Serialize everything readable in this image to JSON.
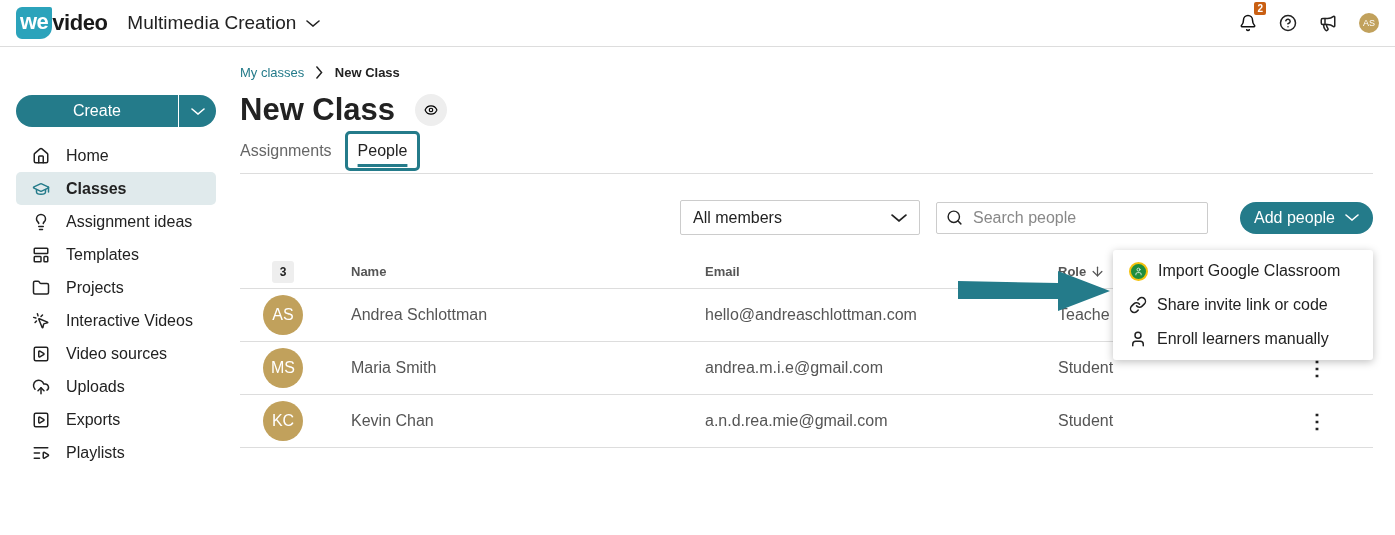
{
  "header": {
    "logo": {
      "mark": "we",
      "word": "video"
    },
    "workspace": "Multimedia Creation",
    "notification_count": "2",
    "avatar": "AS"
  },
  "sidebar": {
    "create_button": "Create",
    "items": [
      {
        "label": "Home",
        "selected": false
      },
      {
        "label": "Classes",
        "selected": true
      },
      {
        "label": "Assignment ideas",
        "selected": false
      },
      {
        "label": "Templates",
        "selected": false
      },
      {
        "label": "Projects",
        "selected": false
      },
      {
        "label": "Interactive Videos",
        "selected": false
      },
      {
        "label": "Video sources",
        "selected": false
      },
      {
        "label": "Uploads",
        "selected": false
      },
      {
        "label": "Exports",
        "selected": false
      },
      {
        "label": "Playlists",
        "selected": false
      }
    ]
  },
  "breadcrumb": [
    {
      "label": "My classes"
    },
    {
      "label": "New Class"
    }
  ],
  "title": "New Class",
  "tabs": [
    {
      "label": "Assignments",
      "selected": false
    },
    {
      "label": "People",
      "selected": true
    }
  ],
  "filter": {
    "value": "All members"
  },
  "search": {
    "placeholder": "Search people"
  },
  "add_button": "Add people",
  "add_menu": [
    {
      "label": "Import Google Classroom"
    },
    {
      "label": "Share invite link or code"
    },
    {
      "label": "Enroll learners manually"
    }
  ],
  "table": {
    "count": "3",
    "columns": [
      "Name",
      "Email",
      "Role"
    ],
    "rows": [
      {
        "initials": "AS",
        "name": "Andrea Schlottman",
        "email": "hello@andreaschlottman.com",
        "role": "Teache"
      },
      {
        "initials": "MS",
        "name": "Maria Smith",
        "email": "andrea.m.i.e@gmail.com",
        "role": "Student",
        "more": "⋮"
      },
      {
        "initials": "KC",
        "name": "Kevin Chan",
        "email": "a.n.d.rea.mie@gmail.com",
        "role": "Student",
        "more": "⋮"
      }
    ]
  }
}
